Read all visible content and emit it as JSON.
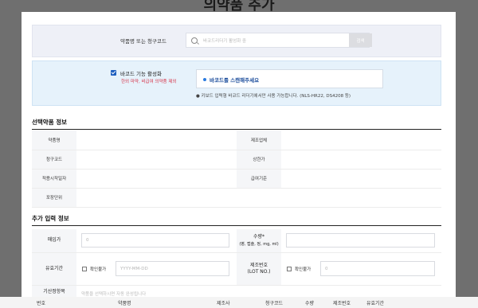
{
  "page_title": "의약품 추가",
  "search": {
    "label": "약품명 또는 청구코드",
    "placeholder": "바코드리더기 활성화 중",
    "button": "검색"
  },
  "barcode": {
    "checkbox_label": "바코드 기능 활성화",
    "warning": "한외 마약, 비급여 의약품 제외",
    "scan_prompt": "바코드를 스캔해주세요",
    "note": "● 키보드 입력형 바코드 리더기에서만 사용 가능합니다. (NLS-HR22, DS4208 등)"
  },
  "selected": {
    "title": "선택약품 정보",
    "rows": [
      {
        "left_label": "약품명",
        "left_value": "",
        "right_label": "제조업체",
        "right_value": ""
      },
      {
        "left_label": "청구코드",
        "left_value": "",
        "right_label": "상한가",
        "right_value": ""
      },
      {
        "left_label": "적용시작일자",
        "left_value": "",
        "right_label": "급여기준",
        "right_value": ""
      },
      {
        "left_label": "포장단위",
        "left_value": ""
      }
    ]
  },
  "additional": {
    "title": "추가 입력 정보",
    "purchase_price_label": "매입가",
    "purchase_price_value": "0",
    "quantity_label": "수량*",
    "quantity_sub": "(병, 캡슐, 정, mg, ml)",
    "quantity_value": "",
    "expiry_label": "유효기간",
    "expiry_unknown": "확인불가",
    "expiry_placeholder": "YYYY-MM-DD",
    "lot_label": "제조번호",
    "lot_sub": "(LOT NO.)",
    "lot_unknown": "확인불가",
    "lot_value": "0",
    "memo_label": "기산정항목",
    "memo_hint": "약품을 선택하시면 자동 완성됩니다"
  },
  "footer_columns": [
    "번호",
    "약품명",
    "제조사",
    "청구코드",
    "수량",
    "제조번호",
    "유효기간"
  ]
}
